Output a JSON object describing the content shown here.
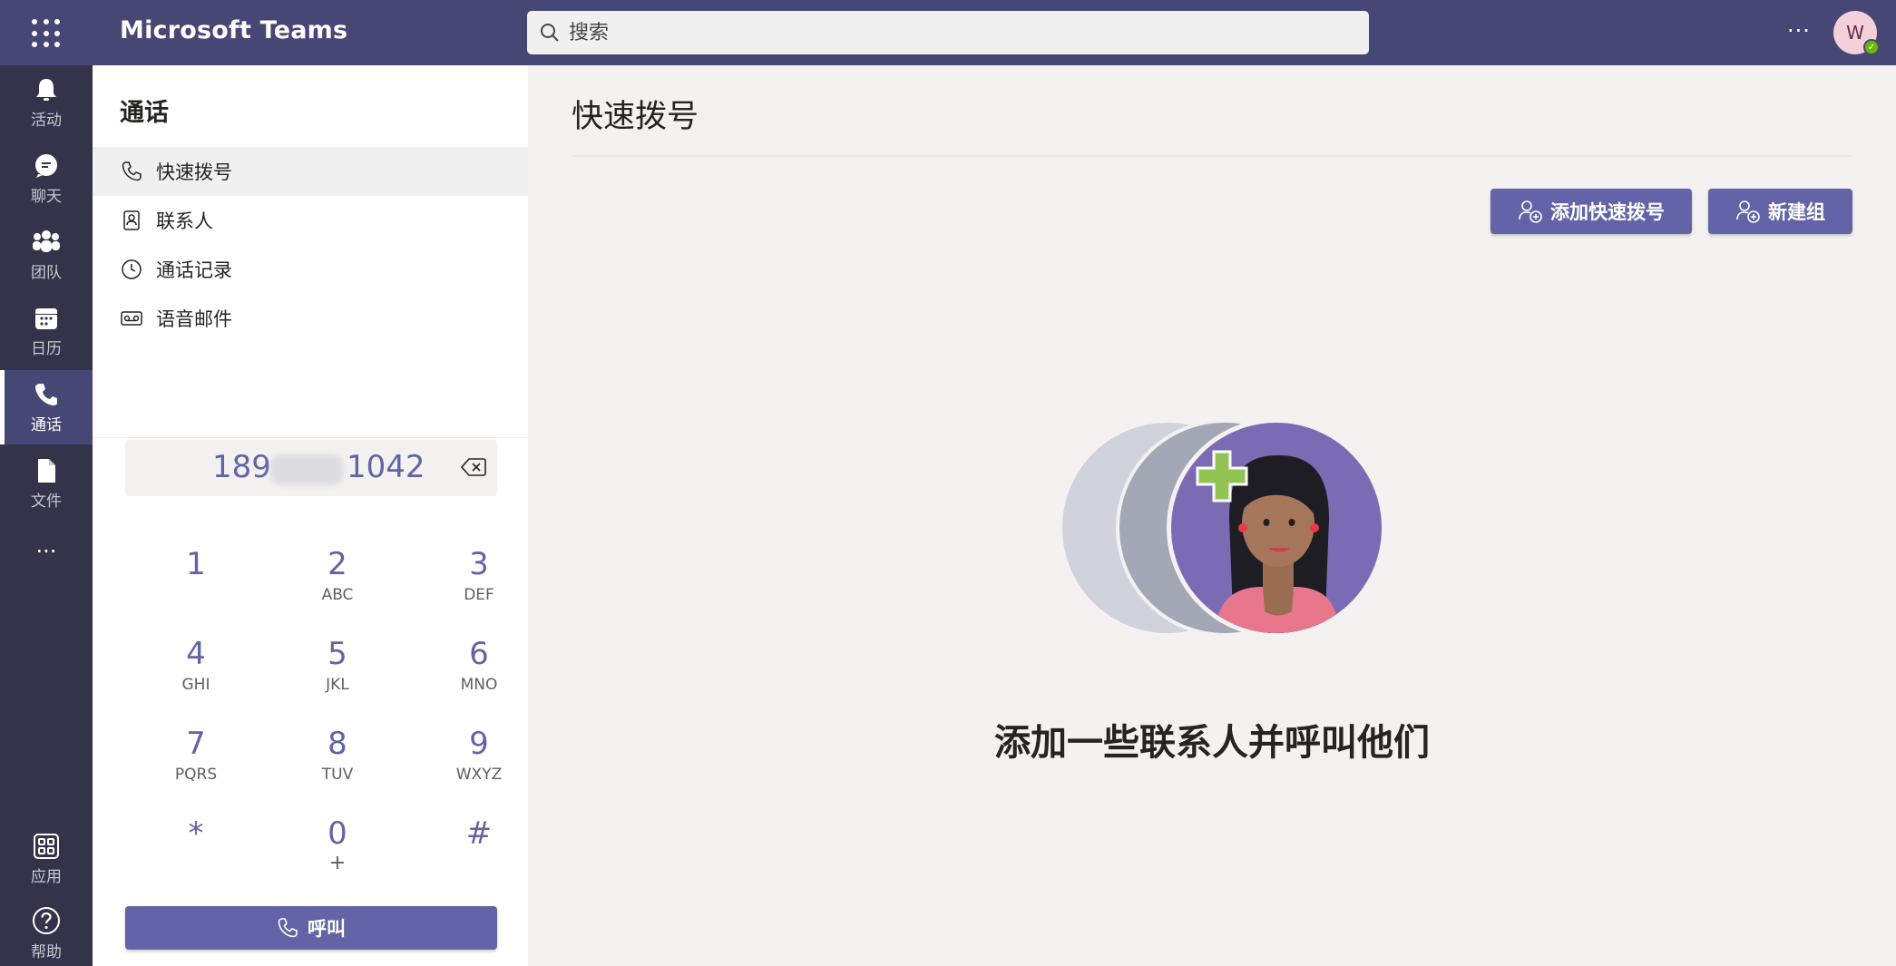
{
  "header": {
    "app_title": "Microsoft Teams",
    "search_placeholder": "搜索",
    "more": "···",
    "avatar_initial": "W",
    "presence": "✓"
  },
  "rail": {
    "items": [
      {
        "label": "活动",
        "icon": "bell-icon"
      },
      {
        "label": "聊天",
        "icon": "chat-icon"
      },
      {
        "label": "团队",
        "icon": "teams-icon"
      },
      {
        "label": "日历",
        "icon": "calendar-icon"
      },
      {
        "label": "通话",
        "icon": "phone-icon",
        "active": true
      },
      {
        "label": "文件",
        "icon": "file-icon"
      }
    ],
    "more": "···",
    "bottom": [
      {
        "label": "应用",
        "icon": "apps-icon"
      },
      {
        "label": "帮助",
        "icon": "help-icon"
      }
    ]
  },
  "panel": {
    "title": "通话",
    "nav": [
      {
        "label": "快速拨号",
        "icon": "phone-outline-icon",
        "active": true
      },
      {
        "label": "联系人",
        "icon": "contacts-icon"
      },
      {
        "label": "通话记录",
        "icon": "clock-icon"
      },
      {
        "label": "语音邮件",
        "icon": "voicemail-icon"
      }
    ],
    "dial": {
      "number_start": "189",
      "number_end": "1042"
    },
    "keys": [
      {
        "digit": "1",
        "letters": ""
      },
      {
        "digit": "2",
        "letters": "ABC"
      },
      {
        "digit": "3",
        "letters": "DEF"
      },
      {
        "digit": "4",
        "letters": "GHI"
      },
      {
        "digit": "5",
        "letters": "JKL"
      },
      {
        "digit": "6",
        "letters": "MNO"
      },
      {
        "digit": "7",
        "letters": "PQRS"
      },
      {
        "digit": "8",
        "letters": "TUV"
      },
      {
        "digit": "9",
        "letters": "WXYZ"
      },
      {
        "digit": "*",
        "letters": ""
      },
      {
        "digit": "0",
        "letters": "+"
      },
      {
        "digit": "#",
        "letters": ""
      }
    ],
    "call_label": "呼叫"
  },
  "main": {
    "title": "快速拨号",
    "add_speed_dial": "添加快速拨号",
    "new_group": "新建组",
    "empty_message": "添加一些联系人并呼叫他们"
  },
  "colors": {
    "brand": "#6264a7",
    "topbar": "#464775",
    "rail": "#33344a"
  }
}
